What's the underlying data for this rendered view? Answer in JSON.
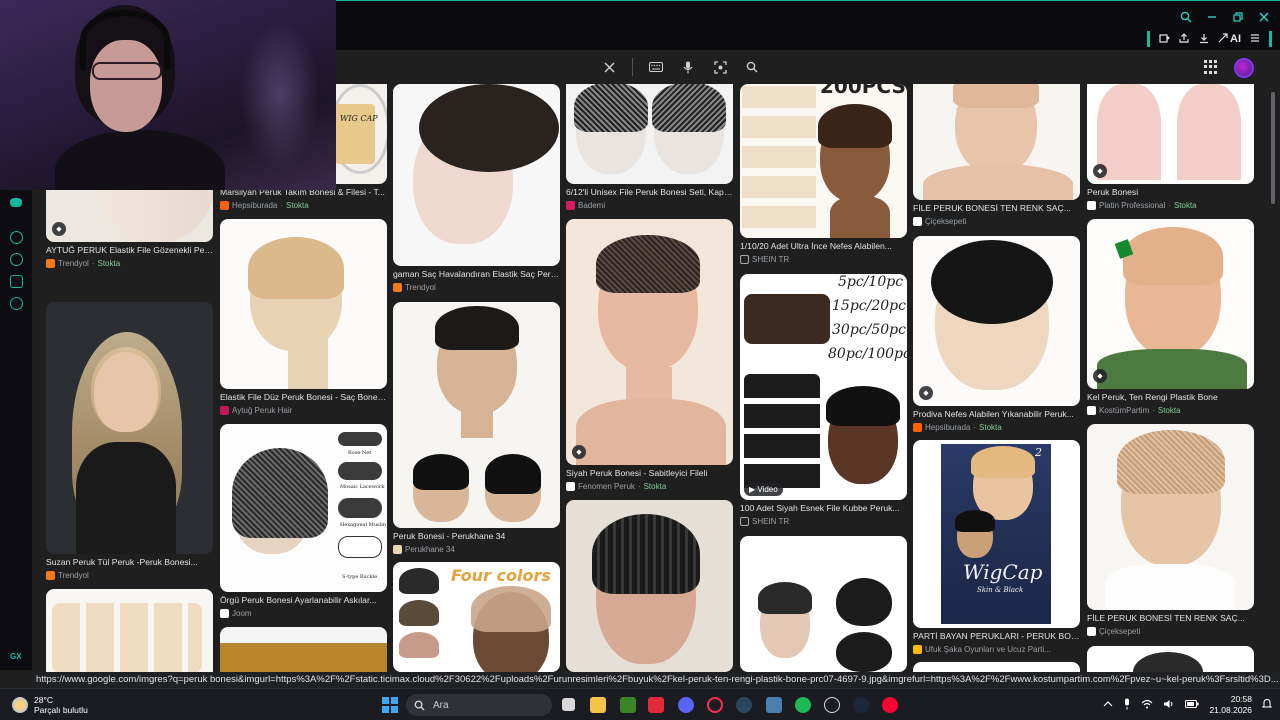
{
  "browser": {
    "window_controls": [
      "search-icon",
      "minimize-icon",
      "restore-icon",
      "close-icon"
    ],
    "toolbar_right": [
      "extensions-icon",
      "share-icon",
      "download-icon",
      "ai-icon",
      "menu-icon"
    ],
    "ai_label": "AI",
    "search_actions": [
      "clear-icon",
      "keyboard-icon",
      "mic-icon",
      "lens-icon",
      "search-icon"
    ]
  },
  "sidebar": {
    "gx_label": "GX"
  },
  "results": [
    {
      "title": "",
      "source": "",
      "stock": ""
    },
    {
      "title": "AYTUĞ PERUK Elastik File Gözenekli Peru...",
      "source": "Trendyol",
      "stock": "Stokta"
    },
    {
      "title": "Suzan Peruk Tül Peruk -Peruk Bonesi...",
      "source": "Trendyol",
      "stock": ""
    },
    {
      "title": "",
      "source": "",
      "stock": ""
    },
    {
      "title": "Marsilyan Peruk Takım Bonesi & Filesi - T...",
      "source": "Hepsiburada",
      "stock": "Stokta"
    },
    {
      "title": "Elastik File Düz Peruk Bonesi - Saç Bones...",
      "source": "Aytuğ Peruk Hair",
      "stock": ""
    },
    {
      "title": "Örgü Peruk Bonesi Ayarlanabilir Askılar...",
      "source": "Joom",
      "stock": ""
    },
    {
      "title": "",
      "source": "",
      "stock": ""
    },
    {
      "title": "gaman Saç Havalandıran Elastik Saç Peru...",
      "source": "Trendyol",
      "stock": ""
    },
    {
      "title": "Peruk Bonesi - Perukhane 34",
      "source": "Perukhane 34",
      "stock": ""
    },
    {
      "title": "",
      "source": "",
      "stock": ""
    },
    {
      "title": "6/12'li Unisex File Peruk Bonesi Seti, Kapa...",
      "source": "Bademi",
      "stock": ""
    },
    {
      "title": "Siyah Peruk Bonesi - Sabitleyici Fileli",
      "source": "Fenomen Peruk",
      "stock": "Stokta"
    },
    {
      "title": "",
      "source": "",
      "stock": ""
    },
    {
      "title": "1/10/20 Adet Ultra İnce Nefes Alabilen...",
      "source": "SHEIN TR",
      "stock": ""
    },
    {
      "title": "100 Adet Siyah Esnek File Kubbe Peruk...",
      "source": "SHEIN TR",
      "stock": ""
    },
    {
      "title": "",
      "source": "",
      "stock": ""
    },
    {
      "title": "FİLE PERUK BONESİ TEN RENK SAÇ...",
      "source": "Çiçeksepeti",
      "stock": ""
    },
    {
      "title": "Prodiva Nefes Alabilen Yıkanabilir Peruk...",
      "source": "Hepsiburada",
      "stock": "Stokta"
    },
    {
      "title": "PARTİ BAYAN PERUKLARI - PERUK BONE...",
      "source": "Ufuk Şaka Oyunları ve Ucuz Parti...",
      "stock": ""
    },
    {
      "title": "Peruk Bonesi",
      "source": "Platin Professional",
      "stock": "Stokta"
    },
    {
      "title": "Kel Peruk, Ten Rengi Plastik Bone",
      "source": "KostümPartim",
      "stock": "Stokta"
    },
    {
      "title": "FİLE PERUK BONESİ TEN RENK SAÇ...",
      "source": "Çiçeksepeti",
      "stock": ""
    }
  ],
  "image_texts": {
    "pcs_top": "200PCS",
    "wig_cap_small": "WIG CAP",
    "pc_lines": [
      "5pc/10pc",
      "15pc/20pc",
      "30pc/50pc",
      "80pc/100pc"
    ],
    "four_colors": "Four colors",
    "net_labels": [
      "Rose Net",
      "Mosaic Lacework",
      "Hexagonal Muslin",
      "S-type Buckle"
    ],
    "wigcap_brand": "WigCap",
    "wigcap_sub": "Skin & Black",
    "wigcap_num": "2",
    "video_label": "Video"
  },
  "status_url": "https://www.google.com/imgres?q=peruk bonesi&imgurl=https%3A%2F%2Fstatic.ticimax.cloud%2F30622%2Fuploads%2Furunresimleri%2Fbuyuk%2Fkel-peruk-ten-rengi-plastik-bone-prc07-4697-9.jpg&imgrefurl=https%3A%2F%2Fwww.kostumpartim.com%2Fpvez~u~kel-peruk%3Fsrsltid%3D...",
  "taskbar": {
    "temperature": "28°C",
    "weather": "Parçalı bulutlu",
    "search_label": "Ara",
    "time": "20:58",
    "date": "21.08.2026"
  },
  "colors": {
    "accent": "#14b8a0",
    "stock_green": "#81c995",
    "background": "#1f1f1f"
  }
}
